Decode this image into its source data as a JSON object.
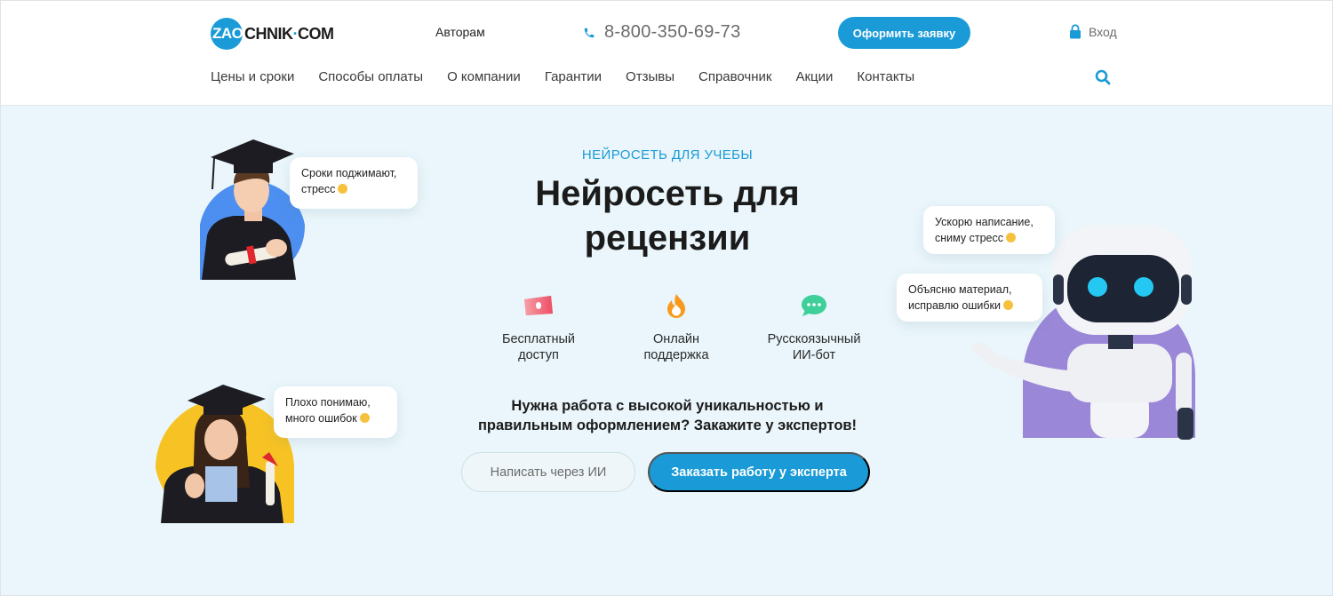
{
  "header": {
    "logo_zao": "ZAO",
    "logo_rest": "CHNIK",
    "logo_dot": "·",
    "logo_com": "COM",
    "authors_link": "Авторам",
    "phone": "8-800-350-69-73",
    "request_button": "Оформить заявку",
    "login": "Вход",
    "nav": [
      "Цены и сроки",
      "Способы оплаты",
      "О компании",
      "Гарантии",
      "Отзывы",
      "Справочник",
      "Акции",
      "Контакты"
    ]
  },
  "hero": {
    "eyebrow": "НЕЙРОСЕТЬ ДЛЯ УЧЕБЫ",
    "title_line1": "Нейросеть для",
    "title_line2": "рецензии",
    "features": [
      {
        "icon": "money-icon",
        "line1": "Бесплатный",
        "line2": "доступ"
      },
      {
        "icon": "fire-icon",
        "line1": "Онлайн",
        "line2": "поддержка"
      },
      {
        "icon": "chat-icon",
        "line1": "Русскоязычный",
        "line2": "ИИ-бот"
      }
    ],
    "cta_line1": "Нужна работа с высокой уникальностью и",
    "cta_line2": "правильным оформлением? Закажите у экспертов!",
    "btn_ai": "Написать через ИИ",
    "btn_expert": "Заказать работу у эксперта",
    "bubbles": {
      "student_male_l1": "Сроки поджимают,",
      "student_male_l2": "стресс",
      "student_female_l1": "Плохо понимаю,",
      "student_female_l2": "много ошибок",
      "robot_1_l1": "Ускорю написание,",
      "robot_1_l2": "сниму стресс",
      "robot_2_l1": "Объясню материал,",
      "robot_2_l2": "исправлю ошибки"
    }
  },
  "colors": {
    "accent": "#1a9bd7",
    "hero_bg": "#eaf6fb",
    "robot_circle": "#9b87d8",
    "student_circle_blue": "#4d8ff0",
    "student_circle_yellow": "#f7c324"
  }
}
